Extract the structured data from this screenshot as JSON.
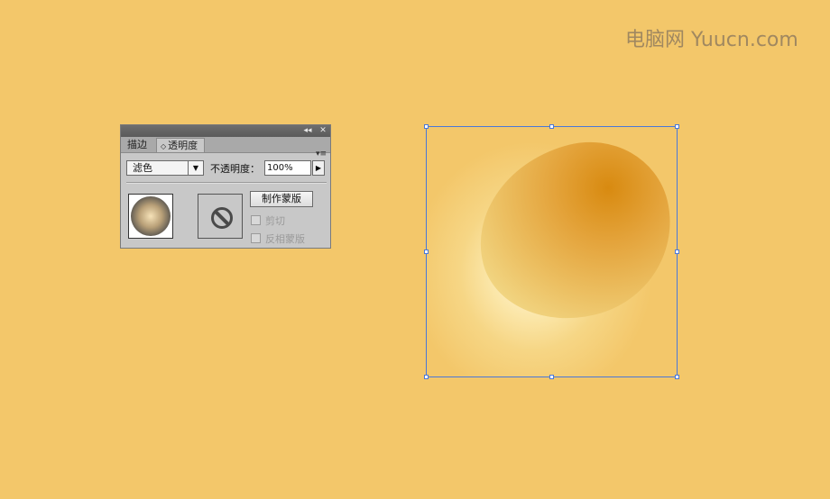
{
  "watermark": "电脑网 Yuucn.com",
  "panel": {
    "titlebar": {
      "collapse_glyph": "◂◂",
      "close_glyph": "✕"
    },
    "tabs": [
      {
        "label": "描边",
        "active": false
      },
      {
        "label": "透明度",
        "active": true,
        "arrows": "◇"
      }
    ],
    "menu_glyph": "▾≡",
    "blend_mode": {
      "value": "滤色",
      "dropdown_glyph": "▼"
    },
    "opacity": {
      "label": "不透明度：",
      "value": "100%",
      "arrow_glyph": "▶"
    },
    "make_mask_label": "制作蒙版",
    "checkboxes": [
      {
        "label": "剪切",
        "checked": false,
        "enabled": false
      },
      {
        "label": "反相蒙版",
        "checked": false,
        "enabled": false
      }
    ],
    "thumbnail_icon": "radial-gradient-circle",
    "mask_thumbnail_icon": "no-mask-icon"
  },
  "colors": {
    "background": "#f3c76a",
    "selection": "#4a78d8",
    "object_highlight": "#d88a10"
  }
}
